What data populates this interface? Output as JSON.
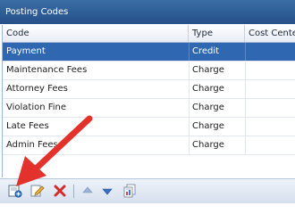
{
  "window": {
    "title": "Posting Codes"
  },
  "columns": [
    "Code",
    "Type",
    "Cost Center"
  ],
  "rows": [
    {
      "code": "Payment",
      "type": "Credit",
      "cost_center": "",
      "selected": true
    },
    {
      "code": "Maintenance Fees",
      "type": "Charge",
      "cost_center": ""
    },
    {
      "code": "Attorney Fees",
      "type": "Charge",
      "cost_center": ""
    },
    {
      "code": "Violation Fine",
      "type": "Charge",
      "cost_center": ""
    },
    {
      "code": "Late Fees",
      "type": "Charge",
      "cost_center": ""
    },
    {
      "code": "Admin Fees",
      "type": "Charge",
      "cost_center": ""
    }
  ],
  "toolbar": {
    "buttons": [
      {
        "icon": "add-record-icon"
      },
      {
        "icon": "edit-pencil-icon"
      },
      {
        "icon": "delete-x-icon"
      },
      {
        "icon": "move-up-icon"
      },
      {
        "icon": "move-down-icon"
      },
      {
        "icon": "report-icon"
      }
    ]
  },
  "colors": {
    "title_bar": "#2d5c97",
    "selected_row": "#2f67b1",
    "annotation_arrow": "#e3322b"
  }
}
